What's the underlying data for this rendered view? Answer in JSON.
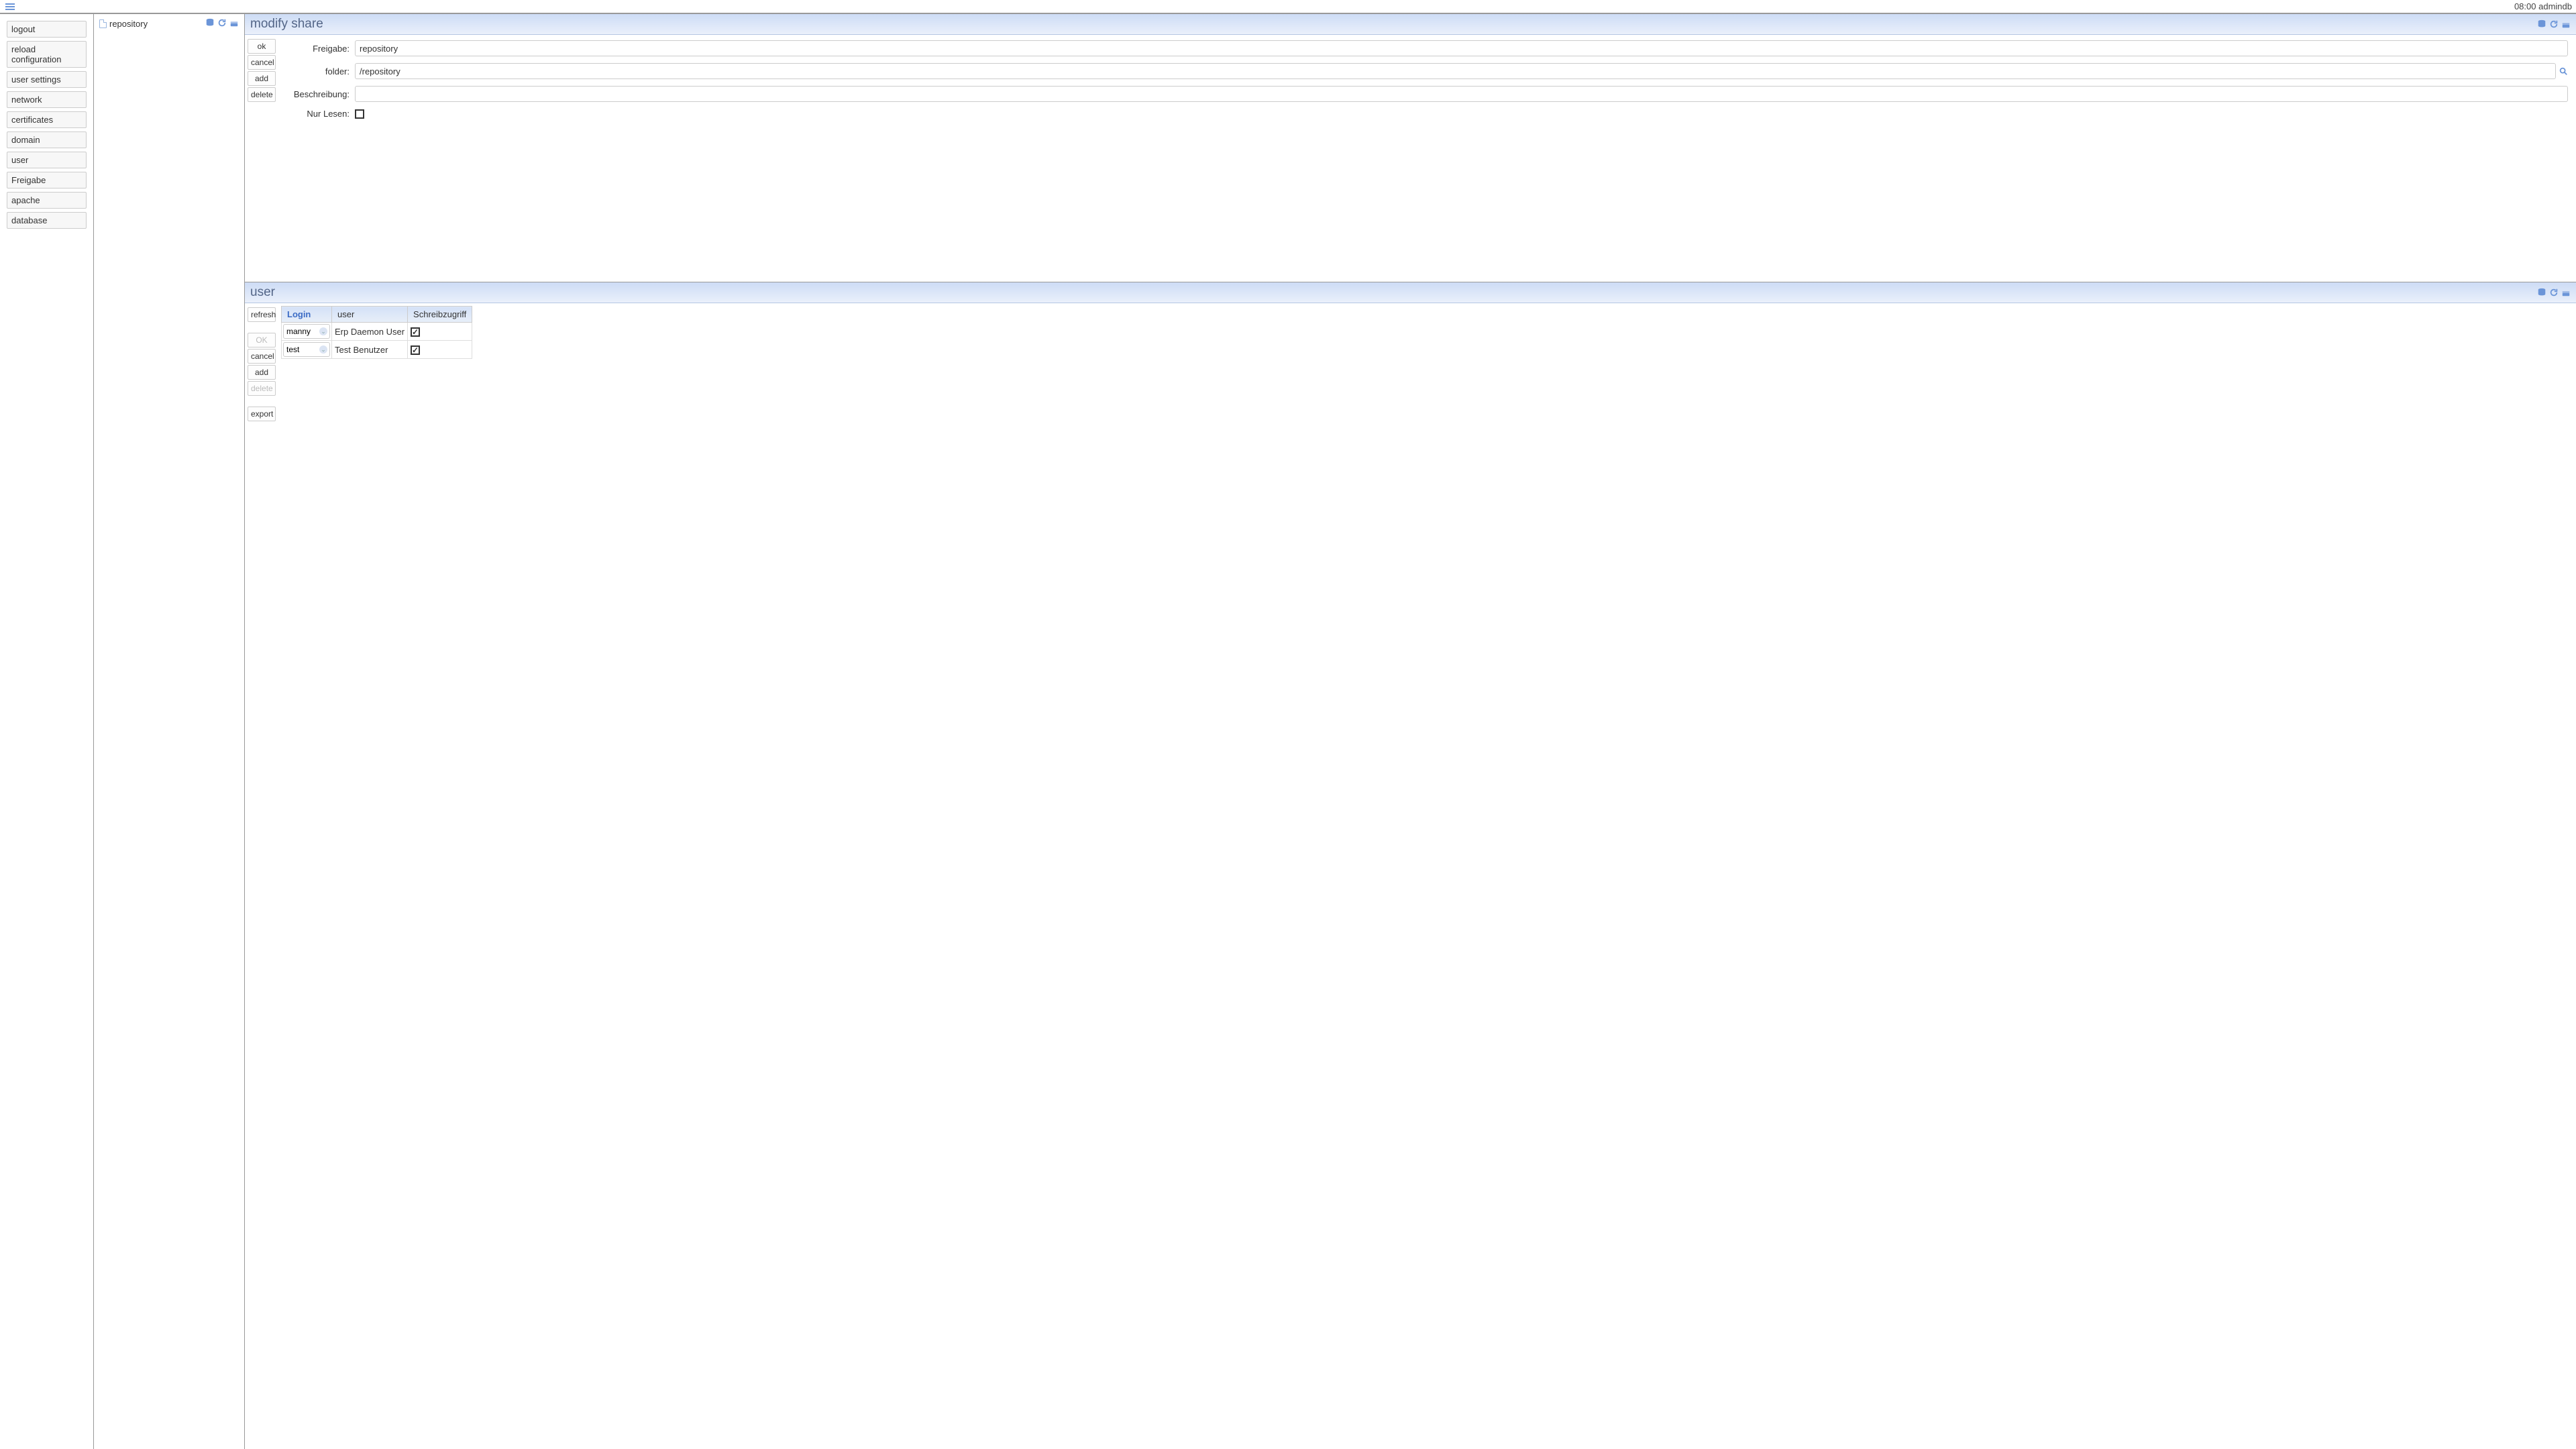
{
  "topbar": {
    "time": "08:00",
    "user": "admindb"
  },
  "menu": {
    "items": [
      "logout",
      "reload configuration",
      "user settings",
      "network",
      "certificates",
      "domain",
      "user",
      "Freigabe",
      "apache",
      "database"
    ]
  },
  "tree": {
    "items": [
      {
        "label": "repository"
      }
    ]
  },
  "panels": {
    "share": {
      "title": "modify share",
      "actions": {
        "ok": "ok",
        "cancel": "cancel",
        "add": "add",
        "delete": "delete"
      },
      "form": {
        "freigabe": {
          "label": "Freigabe:",
          "value": "repository"
        },
        "folder": {
          "label": "folder:",
          "value": "/repository"
        },
        "beschreibung": {
          "label": "Beschreibung:",
          "value": ""
        },
        "nurlesen": {
          "label": "Nur Lesen:",
          "checked": false
        }
      }
    },
    "user": {
      "title": "user",
      "actions": {
        "refresh": "refresh",
        "ok": "OK",
        "cancel": "cancel",
        "add": "add",
        "delete": "delete",
        "export": "export"
      },
      "table": {
        "headers": {
          "login": "Login",
          "user": "user",
          "schreib": "Schreibzugriff"
        },
        "rows": [
          {
            "login": "manny",
            "user": "Erp Daemon User",
            "schreib": true
          },
          {
            "login": "test",
            "user": "Test Benutzer",
            "schreib": true
          }
        ]
      }
    }
  }
}
